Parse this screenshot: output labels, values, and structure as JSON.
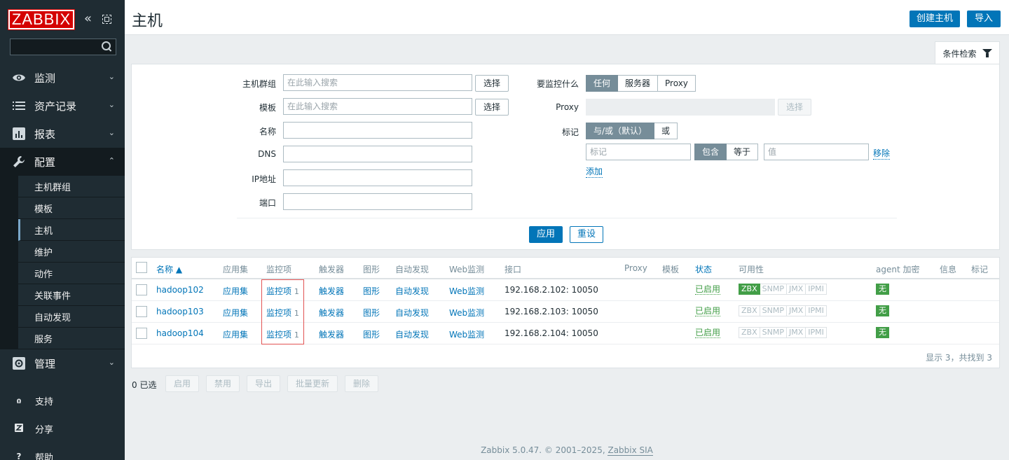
{
  "sidebar": {
    "logo": "ZABBIX",
    "collapse_icon": "«",
    "search_value": "",
    "menu": [
      {
        "label": "监测",
        "icon": "eye-icon",
        "expanded": false
      },
      {
        "label": "资产记录",
        "icon": "list-icon",
        "expanded": false
      },
      {
        "label": "报表",
        "icon": "bar-chart-icon",
        "expanded": false
      },
      {
        "label": "配置",
        "icon": "wrench-icon",
        "expanded": true
      },
      {
        "label": "管理",
        "icon": "gear-icon",
        "expanded": false
      }
    ],
    "submenu": [
      "主机群组",
      "模板",
      "主机",
      "维护",
      "动作",
      "关联事件",
      "自动发现",
      "服务"
    ],
    "support": [
      {
        "label": "支持",
        "icon": "headset-icon"
      },
      {
        "label": "分享",
        "icon": "share-icon"
      },
      {
        "label": "帮助",
        "icon": "help-icon"
      }
    ]
  },
  "header": {
    "title": "主机",
    "create_button": "创建主机",
    "import_button": "导入"
  },
  "filter": {
    "tab_label": "条件检索",
    "host_group_label": "主机群组",
    "host_group_placeholder": "在此输入搜索",
    "template_label": "模板",
    "template_placeholder": "在此输入搜索",
    "select_button": "选择",
    "name_label": "名称",
    "dns_label": "DNS",
    "ip_label": "IP地址",
    "port_label": "端口",
    "monitored_by_label": "要监控什么",
    "monitored_by_options": [
      "任何",
      "服务器",
      "Proxy"
    ],
    "proxy_label": "Proxy",
    "tags_label": "标记",
    "tags_mode_options": [
      "与/或（默认）",
      "或"
    ],
    "tag_placeholder": "标记",
    "tag_operator_options": [
      "包含",
      "等于"
    ],
    "value_placeholder": "值",
    "remove_link": "移除",
    "add_link": "添加",
    "apply_button": "应用",
    "reset_button": "重设"
  },
  "table": {
    "columns": [
      "名称 ▲",
      "应用集",
      "监控项",
      "触发器",
      "图形",
      "自动发现",
      "Web监测",
      "接口",
      "Proxy",
      "模板",
      "状态",
      "可用性",
      "agent 加密",
      "信息",
      "标记"
    ],
    "rows": [
      {
        "name": "hadoop102",
        "apps": "应用集",
        "items": "监控项",
        "items_count": "1",
        "triggers": "触发器",
        "graphs": "图形",
        "discovery": "自动发现",
        "web": "Web监测",
        "interface": "192.168.2.102: 10050",
        "status": "已启用",
        "availability": [
          "ZBX",
          "SNMP",
          "JMX",
          "IPMI"
        ],
        "zbx_on": true,
        "encryption": "无"
      },
      {
        "name": "hadoop103",
        "apps": "应用集",
        "items": "监控项",
        "items_count": "1",
        "triggers": "触发器",
        "graphs": "图形",
        "discovery": "自动发现",
        "web": "Web监测",
        "interface": "192.168.2.103: 10050",
        "status": "已启用",
        "availability": [
          "ZBX",
          "SNMP",
          "JMX",
          "IPMI"
        ],
        "zbx_on": false,
        "encryption": "无"
      },
      {
        "name": "hadoop104",
        "apps": "应用集",
        "items": "监控项",
        "items_count": "1",
        "triggers": "触发器",
        "graphs": "图形",
        "discovery": "自动发现",
        "web": "Web监测",
        "interface": "192.168.2.104: 10050",
        "status": "已启用",
        "availability": [
          "ZBX",
          "SNMP",
          "JMX",
          "IPMI"
        ],
        "zbx_on": false,
        "encryption": "无"
      }
    ],
    "summary": "显示 3，共找到 3"
  },
  "actions": {
    "selected": "0 已选",
    "buttons": [
      "启用",
      "禁用",
      "导出",
      "批量更新",
      "删除"
    ]
  },
  "footer": {
    "text": "Zabbix 5.0.47. © 2001–2025, ",
    "link": "Zabbix SIA"
  },
  "colors": {
    "sidebar_bg": "#1f2c33",
    "accent": "#0275b8",
    "status_green": "#429e47",
    "logo_red": "#d40000",
    "highlight_red": "#e25353"
  }
}
